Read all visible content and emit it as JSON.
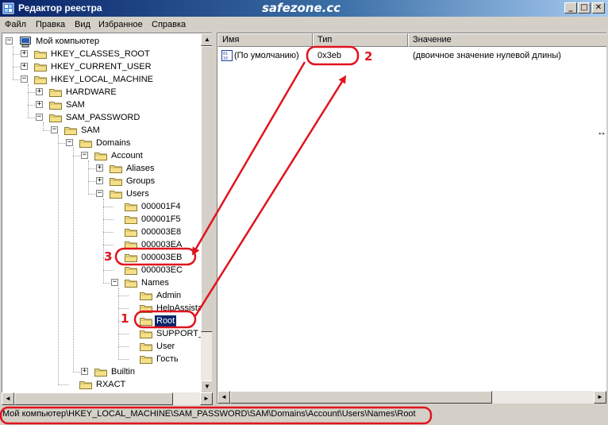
{
  "window": {
    "title": "Редактор реестра",
    "watermark": "safezone.cc",
    "minimize_label": "_",
    "maximize_label": "□",
    "close_label": "✕",
    "accent": "#0a246a"
  },
  "menu": [
    "Файл",
    "Правка",
    "Вид",
    "Избранное",
    "Справка"
  ],
  "tree": [
    {
      "label": "Мой компьютер",
      "level": 0,
      "expanded": true,
      "icon": "computer-icon"
    },
    {
      "label": "HKEY_CLASSES_ROOT",
      "level": 1,
      "expanded": false
    },
    {
      "label": "HKEY_CURRENT_USER",
      "level": 1,
      "expanded": false
    },
    {
      "label": "HKEY_LOCAL_MACHINE",
      "level": 1,
      "expanded": true
    },
    {
      "label": "HARDWARE",
      "level": 2,
      "expanded": false
    },
    {
      "label": "SAM",
      "level": 2,
      "expanded": false
    },
    {
      "label": "SAM_PASSWORD",
      "level": 2,
      "expanded": true
    },
    {
      "label": "SAM",
      "level": 3,
      "expanded": true
    },
    {
      "label": "Domains",
      "level": 4,
      "expanded": true
    },
    {
      "label": "Account",
      "level": 5,
      "expanded": true
    },
    {
      "label": "Aliases",
      "level": 6,
      "expanded": false
    },
    {
      "label": "Groups",
      "level": 6,
      "expanded": false
    },
    {
      "label": "Users",
      "level": 6,
      "expanded": true
    },
    {
      "label": "000001F4",
      "level": 7
    },
    {
      "label": "000001F5",
      "level": 7
    },
    {
      "label": "000003E8",
      "level": 7
    },
    {
      "label": "000003EA",
      "level": 7
    },
    {
      "label": "000003EB",
      "level": 7
    },
    {
      "label": "000003EC",
      "level": 7
    },
    {
      "label": "Names",
      "level": 7,
      "expanded": true
    },
    {
      "label": "Admin",
      "level": 8
    },
    {
      "label": "HelpAssista",
      "level": 8
    },
    {
      "label": "Root",
      "level": 8,
      "selected": true
    },
    {
      "label": "SUPPORT_",
      "level": 8
    },
    {
      "label": "User",
      "level": 8
    },
    {
      "label": "Гость",
      "level": 8
    },
    {
      "label": "Builtin",
      "level": 5,
      "expanded": false
    },
    {
      "label": "RXACT",
      "level": 4
    }
  ],
  "columns": [
    "Имя",
    "Тип",
    "Значение"
  ],
  "rows": [
    {
      "name": "(По умолчанию)",
      "type": "0x3eb",
      "value": "(двоичное значение нулевой длины)",
      "icon": "binary-value-icon"
    }
  ],
  "status": {
    "path": "Мой компьютер\\HKEY_LOCAL_MACHINE\\SAM_PASSWORD\\SAM\\Domains\\Account\\Users\\Names\\Root"
  },
  "annotations": {
    "color": "#e0141e",
    "step1": "1",
    "step2": "2",
    "step3": "3"
  }
}
